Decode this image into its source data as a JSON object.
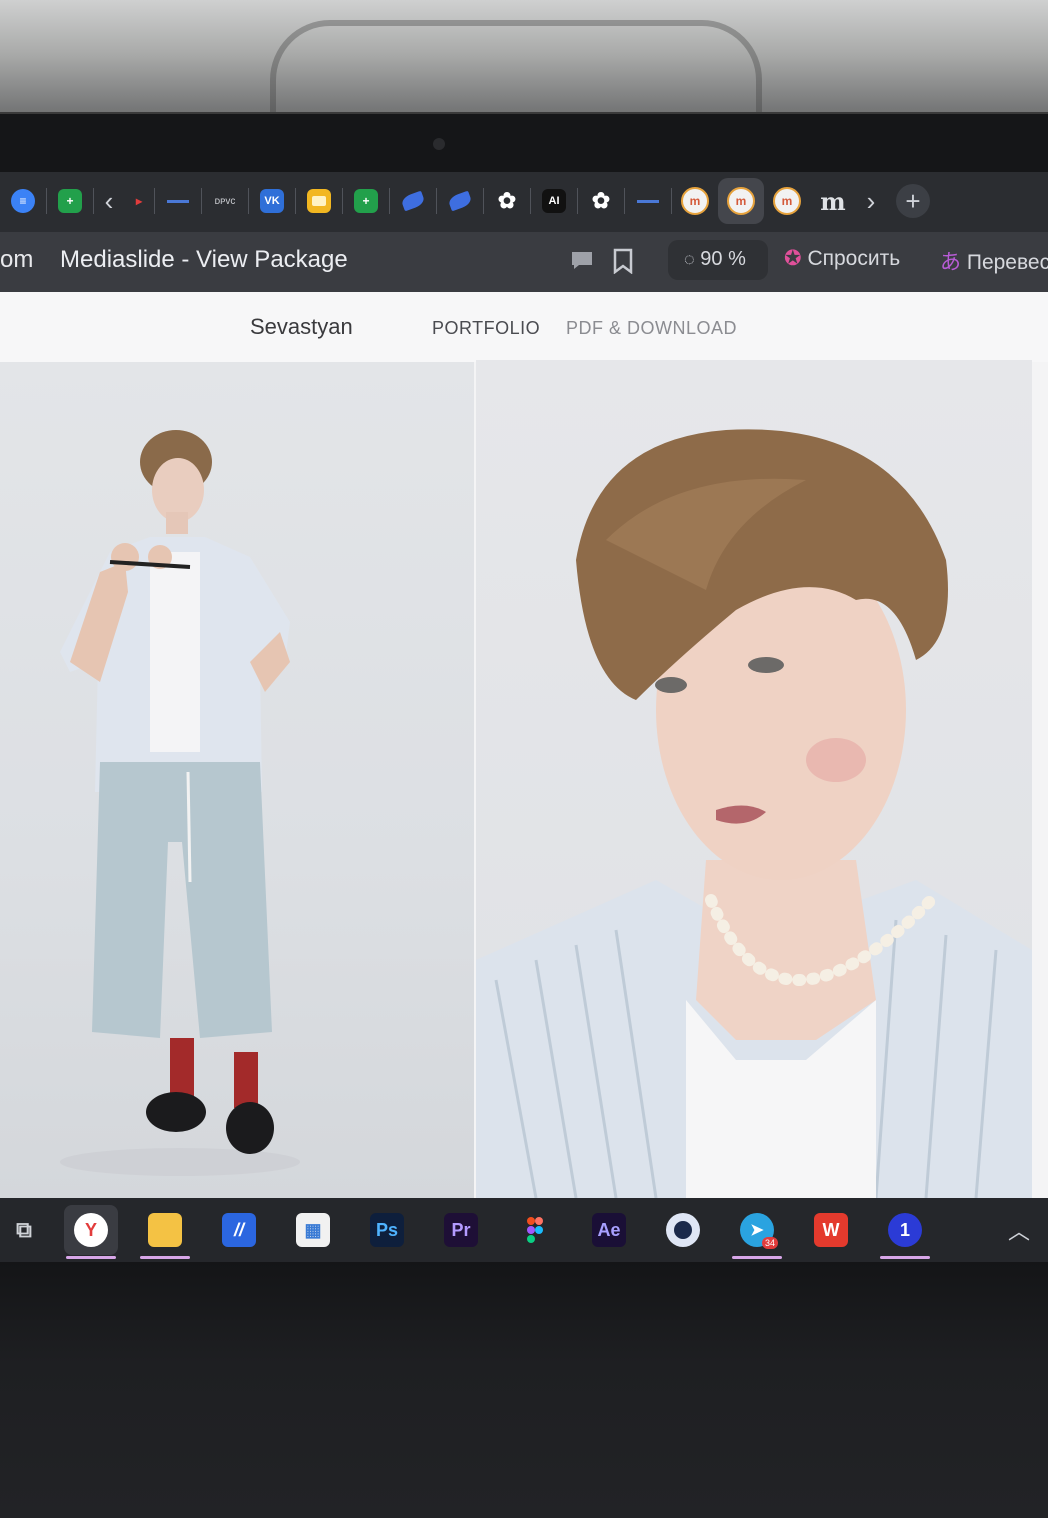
{
  "browser": {
    "tab_titles": [
      "",
      "",
      "",
      "",
      "",
      "",
      "",
      "",
      "",
      "",
      "",
      "",
      "",
      "",
      "",
      "",
      "",
      "",
      ""
    ],
    "tab_icons": [
      "blue-circle-icon",
      "green-plus-icon",
      "red-arrow-icon",
      "blue-line-icon",
      "dark-text-icon",
      "vk-icon",
      "yellow-slide-icon",
      "green-plus-icon",
      "blue-leaf-icon",
      "blue-leaf-icon",
      "flower-icon",
      "ai-icon",
      "flower-icon",
      "blue-line-icon",
      "m-icon",
      "m-icon",
      "m-icon",
      "m-one-icon"
    ],
    "tab_text": {
      "ai": "AI",
      "vk": "VK",
      "dark_text": "ᴅᴘᴠᴄ",
      "m": "m",
      "m_one": "m"
    },
    "page_title_fragment": "om",
    "page_title": "Mediaslide - View Package",
    "zoom": "90 %",
    "ask_label": "Спросить",
    "translate_label": "Перевест"
  },
  "site": {
    "model_name": "Sevastyan",
    "nav": [
      "PORTFOLIO",
      "PDF & DOWNLOAD"
    ]
  },
  "taskbar": {
    "apps": [
      "task-view-icon",
      "yandex-browser-icon",
      "file-explorer-icon",
      "app-icon",
      "microsoft-store-icon",
      "photoshop-icon",
      "premiere-icon",
      "figma-icon",
      "after-effects-icon",
      "cinema4d-icon",
      "telegram-icon",
      "wps-office-icon",
      "app-one-icon"
    ],
    "labels": {
      "ps": "Ps",
      "pr": "Pr",
      "ae": "Ae"
    },
    "telegram_badge": "34"
  },
  "colors": {
    "accent": "#e23c3c",
    "indicator": "#d7a6e8"
  }
}
